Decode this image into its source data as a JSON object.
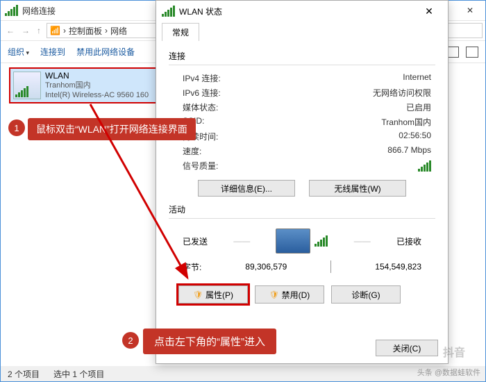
{
  "explorer": {
    "title": "网络连接",
    "breadcrumb": [
      "控制面板",
      "网络"
    ],
    "toolbar": {
      "organize": "组织",
      "connect": "连接到",
      "disable": "禁用此网络设备"
    },
    "statusbar": {
      "count": "2 个项目",
      "selected": "选中 1 个项目"
    }
  },
  "connection": {
    "name": "WLAN",
    "network": "Tranhom国内",
    "adapter": "Intel(R) Wireless-AC 9560 160"
  },
  "dialog": {
    "title": "WLAN 状态",
    "tab": "常规",
    "sections": {
      "connection": "连接",
      "signal_quality": "信号质量:",
      "activity": "活动"
    },
    "rows": {
      "ipv4_label": "IPv4 连接:",
      "ipv4_value": "Internet",
      "ipv6_label": "IPv6 连接:",
      "ipv6_value": "无网络访问权限",
      "media_label": "媒体状态:",
      "media_value": "已启用",
      "ssid_label": "SSID:",
      "ssid_value": "Tranhom国内",
      "duration_label": "持续时间:",
      "duration_value": "02:56:50",
      "speed_label": "速度:",
      "speed_value": "866.7 Mbps"
    },
    "buttons": {
      "details": "详细信息(E)...",
      "wireless_props": "无线属性(W)"
    },
    "activity": {
      "sent_label": "已发送",
      "recv_label": "已接收",
      "bytes_label": "字节:",
      "sent_bytes": "89,306,579",
      "recv_bytes": "154,549,823"
    },
    "bottom_buttons": {
      "properties": "属性(P)",
      "disable": "禁用(D)",
      "diagnose": "诊断(G)"
    },
    "close": "关闭(C)"
  },
  "annotations": {
    "step1_num": "1",
    "step1_text": "鼠标双击“WLAN”打开网络连接界面",
    "step2_num": "2",
    "step2_text": "点击左下角的“属性”进入"
  },
  "watermark": {
    "line1": "抖音",
    "line2": "头条 @数据蛙软件"
  }
}
